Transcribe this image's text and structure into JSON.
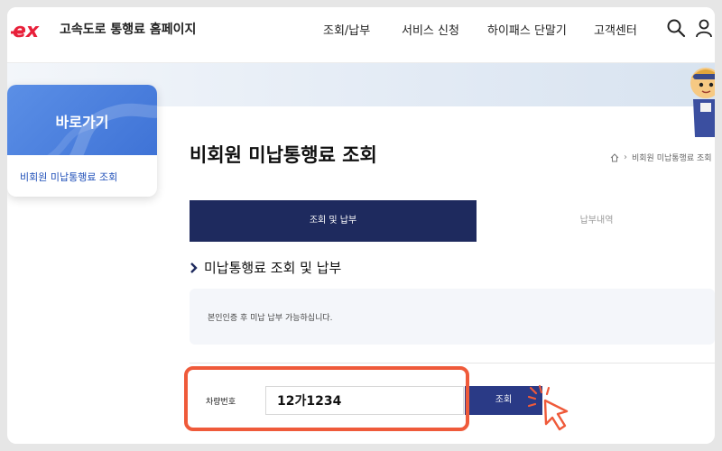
{
  "header": {
    "logo_text": "ex",
    "site_title": "고속도로 통행료 홈페이지",
    "nav": [
      "조회/납부",
      "서비스 신청",
      "하이패스 단말기",
      "고객센터"
    ]
  },
  "sidebar": {
    "title": "바로가기",
    "link": "비회원 미납통행료 조회"
  },
  "main": {
    "page_title": "비회원 미납통행료 조회",
    "breadcrumb": "비회원 미납통행료 조회",
    "tabs": [
      {
        "label": "조회 및 납부",
        "active": true
      },
      {
        "label": "납부내역",
        "active": false
      }
    ],
    "section_heading": "미납통행료 조회 및 납부",
    "notice": "본인인증 후 미납 납부 가능하십니다.",
    "form": {
      "plate_label": "차량번호",
      "plate_value": "12가1234",
      "search_button": "조회"
    }
  },
  "colors": {
    "brand_red": "#e8203a",
    "tab_active_bg": "#1e2a5e",
    "button_bg": "#2a3a86",
    "highlight": "#ef5a3a",
    "sidebar_blue": "#4a7edc"
  },
  "icons": [
    "ex-logo",
    "search-icon",
    "user-icon",
    "home-icon",
    "chevron-right-icon",
    "cursor-click-icon",
    "mascot-image"
  ]
}
